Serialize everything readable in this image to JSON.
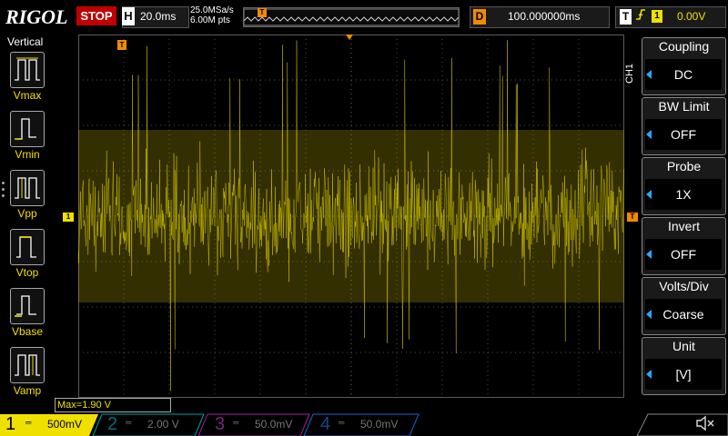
{
  "header": {
    "brand": "RIGOL",
    "run_state": "STOP",
    "horizontal": {
      "letter": "H",
      "timebase": "20.0ms",
      "sample_rate": "25.0MSa/s",
      "memory_depth": "6.00M pts"
    },
    "delay": {
      "letter": "D",
      "value": "100.000000ms"
    },
    "trigger": {
      "letter": "T",
      "edge_icon": "rising-edge-icon",
      "source": "1",
      "level": "0.00V"
    },
    "marker_T": "T"
  },
  "left_panel": {
    "title": "Vertical",
    "items": [
      {
        "label": "Vmax",
        "icon": "vmax-icon"
      },
      {
        "label": "Vmin",
        "icon": "vmin-icon"
      },
      {
        "label": "Vpp",
        "icon": "vpp-icon"
      },
      {
        "label": "Vtop",
        "icon": "vtop-icon"
      },
      {
        "label": "Vbase",
        "icon": "vbase-icon"
      },
      {
        "label": "Vamp",
        "icon": "vamp-icon"
      }
    ]
  },
  "right_menu": {
    "channel_tag": "CH1",
    "items": [
      {
        "title": "Coupling",
        "value": "DC"
      },
      {
        "title": "BW Limit",
        "value": "OFF"
      },
      {
        "title": "Probe",
        "value": "1X"
      },
      {
        "title": "Invert",
        "value": "OFF"
      },
      {
        "title": "Volts/Div",
        "value": "Coarse"
      },
      {
        "title": "Unit",
        "value": "[V]"
      }
    ]
  },
  "markers": {
    "trigger_pos": "T",
    "ch1_ground": "1",
    "trigger_level": "T"
  },
  "measurement": {
    "text": "Max=1.90 V"
  },
  "channels": [
    {
      "number": "1",
      "scale": "500mV",
      "color": "#f0e000",
      "active": true
    },
    {
      "number": "2",
      "scale": "2.00 V",
      "color": "#00c8c8",
      "active": false
    },
    {
      "number": "3",
      "scale": "50.0mV",
      "color": "#e040e0",
      "active": false
    },
    {
      "number": "4",
      "scale": "50.0mV",
      "color": "#2a80ff",
      "active": false
    }
  ],
  "sound_icon": "speaker-muted-icon",
  "colors": {
    "ch1": "#f0e000",
    "stop": "#c00000",
    "delay": "#f08a00",
    "menu_arrow": "#2aa8ff"
  }
}
